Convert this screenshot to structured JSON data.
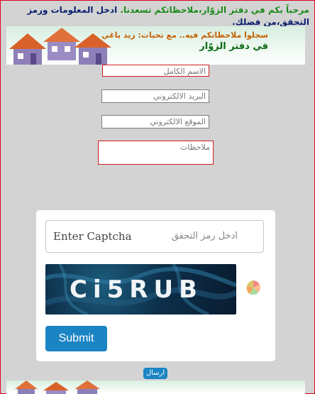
{
  "header": {
    "welcome_part1": "مرحباً بكم في دفتر الزوّار،ملاحظاتكم تسعدنا.",
    "welcome_part2": "ادخل المعلومات ورمز التحقق،من فضلك."
  },
  "banner": {
    "line1": "سجلوا ملاحظاتكم فيه.. مع تحيات: زيد ياغي",
    "line2": "في دفتر الزوّار"
  },
  "form": {
    "name_placeholder": "الاسم الكامل",
    "email_placeholder": "البريد الالكتروني",
    "website_placeholder": "الموقع الالكتروني",
    "notes_placeholder": "ملاحظات"
  },
  "captcha": {
    "label": "Enter Captcha",
    "placeholder": "ادخل رمز التحقق",
    "image_text": "Ci5RUB",
    "submit_label": "Submit"
  },
  "send_label": "ارسال",
  "colors": {
    "accent": "#1b84c4",
    "error_border": "#d11c1c",
    "welcome_green": "#1a8a1a",
    "welcome_navy": "#0a1f6e"
  },
  "icons": {
    "refresh": "refresh-icon",
    "house": "house-icon"
  }
}
